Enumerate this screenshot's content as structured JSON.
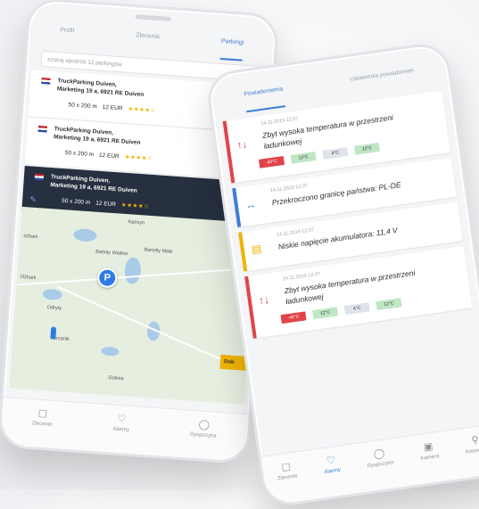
{
  "left_phone": {
    "tabs": [
      {
        "label": "Profil",
        "active": false
      },
      {
        "label": "Zlecenia",
        "active": false
      },
      {
        "label": "Parkingi",
        "active": true
      }
    ],
    "search_placeholder": "szukaj spośród 12 parkingów",
    "parkings": [
      {
        "name": "TruckParking Duiven,",
        "address": "Marketing 19 a, 6921 RE Duiven",
        "size": "50 x 200 m",
        "price": "12 EUR",
        "stars": "★★★★☆",
        "selected": false
      },
      {
        "name": "TruckParking Duiven,",
        "address": "Marketing 19 a, 6921 RE Duiven",
        "size": "50 x 200 m",
        "price": "12 EUR",
        "stars": "★★★★☆",
        "selected": false
      },
      {
        "name": "TruckParking Duiven,",
        "address": "Marketing 19 a, 6921 RE Duiven",
        "size": "50 x 200 m",
        "price": "12 EUR",
        "stars": "★★★★☆",
        "selected": true
      }
    ],
    "map": {
      "places": [
        "Kętrzyn",
        "Barkity Wielkie",
        "Bartołty Małe",
        "szbark",
        "Dźbark",
        "Odryty",
        "Kurzanik",
        "Golinia"
      ],
      "pin_label": "P",
      "dob_label": "Dob"
    },
    "nav": [
      {
        "label": "Zlecenie",
        "icon": "clipboard-icon",
        "active": false
      },
      {
        "label": "Alarmy",
        "icon": "bell-icon",
        "active": false
      },
      {
        "label": "Dyspozytor",
        "icon": "chat-icon",
        "active": false
      }
    ]
  },
  "right_phone": {
    "tabs": [
      {
        "label": "Powiadomienia",
        "active": true
      },
      {
        "label": "Ustawienia powiadomień",
        "active": false
      }
    ],
    "alerts": [
      {
        "type": "temperature",
        "color": "#e0444a",
        "date": "14.11.2019 12:37",
        "text": "Zbyt wysoka temperatura w przestrzeni ładunkowej",
        "temps": [
          "-40°C",
          "12°C",
          "4°C",
          "12°C"
        ]
      },
      {
        "type": "border",
        "color": "#3d7fd6",
        "date": "14.11.2019 12:37",
        "text": "Przekroczono granicę państwa: PL-DE",
        "temps": []
      },
      {
        "type": "battery",
        "color": "#f0b400",
        "date": "14.11.2019 12:37",
        "text": "Niskie napięcie akumulatora: 11,4 V",
        "temps": []
      },
      {
        "type": "temperature",
        "color": "#e0444a",
        "date": "14.11.2019 12:37",
        "text": "Zbyt wysoka temperatura w przestrzeni ładunkowej",
        "temps": [
          "-40°C",
          "12°C",
          "4°C",
          "12°C"
        ]
      }
    ],
    "nav": [
      {
        "label": "Zlecenie",
        "icon": "clipboard-icon",
        "active": false
      },
      {
        "label": "Alarmy",
        "icon": "bell-icon",
        "active": true
      },
      {
        "label": "Dyspozytor",
        "icon": "chat-icon",
        "active": false
      },
      {
        "label": "Kamera",
        "icon": "camera-icon",
        "active": false
      },
      {
        "label": "Kierowca",
        "icon": "key-icon",
        "active": false
      }
    ]
  }
}
